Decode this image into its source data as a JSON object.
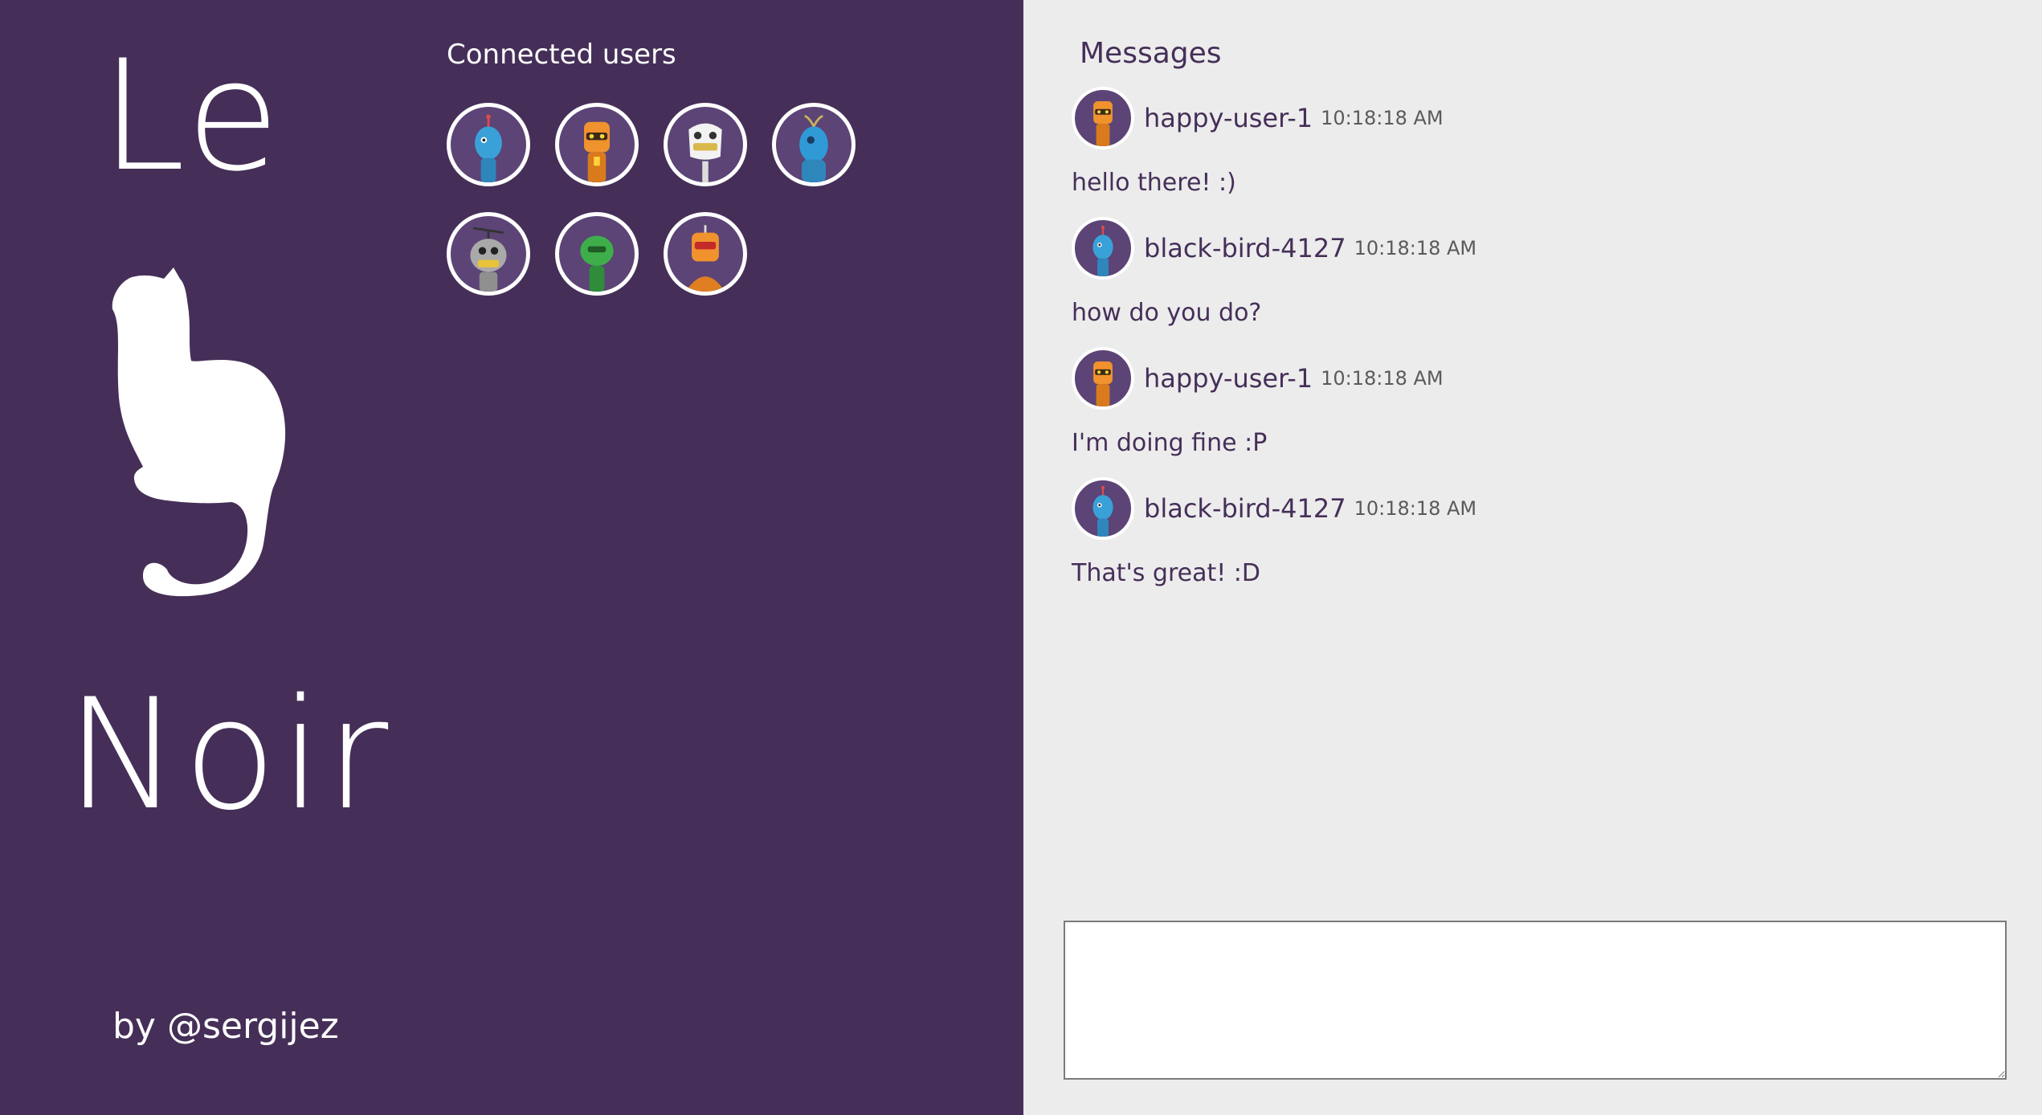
{
  "brand": {
    "title_top": "Le",
    "title_bottom": "Noir",
    "logo_icon": "cat-silhouette-icon",
    "byline": "by @sergijez"
  },
  "users": {
    "title": "Connected users",
    "list": [
      {
        "robot": "blue-antenna-robot-icon",
        "color": "#3aa0d8"
      },
      {
        "robot": "orange-visor-robot-icon",
        "color": "#f0922e"
      },
      {
        "robot": "white-ghost-robot-icon",
        "color": "#f2f2f2"
      },
      {
        "robot": "blue-sprout-robot-icon",
        "color": "#2f9ad6"
      },
      {
        "robot": "grey-propeller-robot-icon",
        "color": "#a9a9a9"
      },
      {
        "robot": "green-robot-icon",
        "color": "#3eae4a"
      },
      {
        "robot": "orange-red-visor-robot-icon",
        "color": "#f0922e"
      }
    ]
  },
  "messages": {
    "title": "Messages",
    "items": [
      {
        "user": "happy-user-1",
        "time": "10:18:18 AM",
        "text": "hello there! :)",
        "avatar": "orange-visor-robot-icon"
      },
      {
        "user": "black-bird-4127",
        "time": "10:18:18 AM",
        "text": "how do you do?",
        "avatar": "blue-antenna-robot-icon"
      },
      {
        "user": "happy-user-1",
        "time": "10:18:18 AM",
        "text": "I'm doing fine :P",
        "avatar": "orange-visor-robot-icon"
      },
      {
        "user": "black-bird-4127",
        "time": "10:18:18 AM",
        "text": "That's great! :D",
        "avatar": "blue-antenna-robot-icon"
      }
    ]
  },
  "composer": {
    "value": "",
    "placeholder": ""
  },
  "colors": {
    "left_panel": "#452f58",
    "right_panel": "#ececec",
    "text_accent": "#452f58",
    "avatar_bg": "#5c4476",
    "white": "#ffffff"
  }
}
